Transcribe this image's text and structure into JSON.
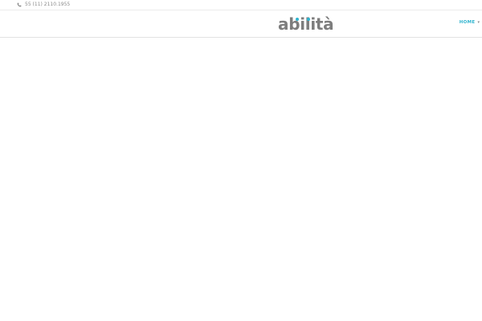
{
  "topbar": {
    "phone_icon": "phone-icon",
    "phone_number": "55 (11) 2110.1955"
  },
  "header": {
    "logo_text": "abilità",
    "logo_accent_color": "#2fb4cf",
    "logo_text_color": "#7d7d7d"
  },
  "nav": {
    "home_label": "HOME",
    "home_caret_icon": "chevron-down-icon",
    "home_color": "#2fb4cf"
  },
  "side_widget": {
    "icon": "loading-spinner-icon"
  }
}
